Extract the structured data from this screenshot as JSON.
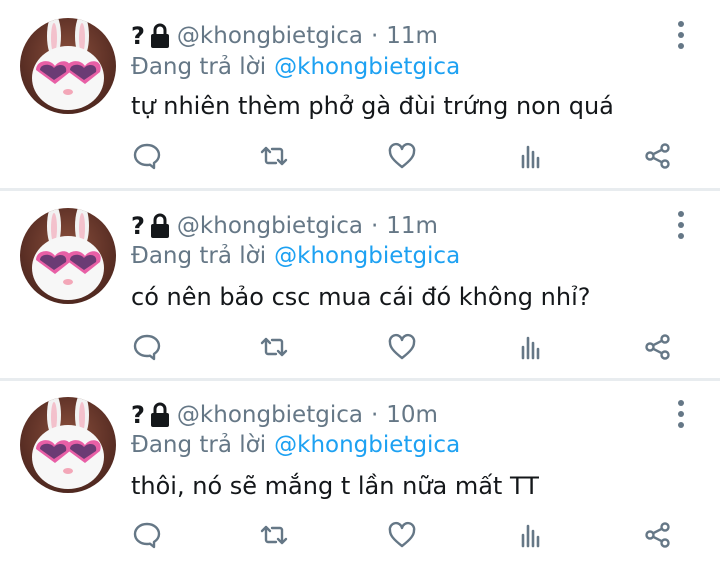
{
  "tweets": [
    {
      "name": "?",
      "handle": "@khongbietgica",
      "separator": "·",
      "time": "11m",
      "reply_prefix": "Đang trả lời",
      "reply_to": "@khongbietgica",
      "text": "tự nhiên thèm phở gà đùi trứng non quá"
    },
    {
      "name": "?",
      "handle": "@khongbietgica",
      "separator": "·",
      "time": "11m",
      "reply_prefix": "Đang trả lời",
      "reply_to": "@khongbietgica",
      "text": "có nên bảo csc mua cái đó không nhỉ?"
    },
    {
      "name": "?",
      "handle": "@khongbietgica",
      "separator": "·",
      "time": "10m",
      "reply_prefix": "Đang trả lời",
      "reply_to": "@khongbietgica",
      "text": "thôi, nó sẽ mắng t lần nữa mất TT"
    }
  ],
  "icons": {
    "lock": "lock-icon",
    "more": "more-vertical-icon",
    "reply": "reply-icon",
    "retweet": "retweet-icon",
    "like": "heart-icon",
    "analytics": "analytics-icon",
    "share": "share-icon"
  },
  "colors": {
    "accent": "#1da1f2",
    "muted": "#657786",
    "text": "#14171a",
    "divider": "#e8ecef"
  }
}
